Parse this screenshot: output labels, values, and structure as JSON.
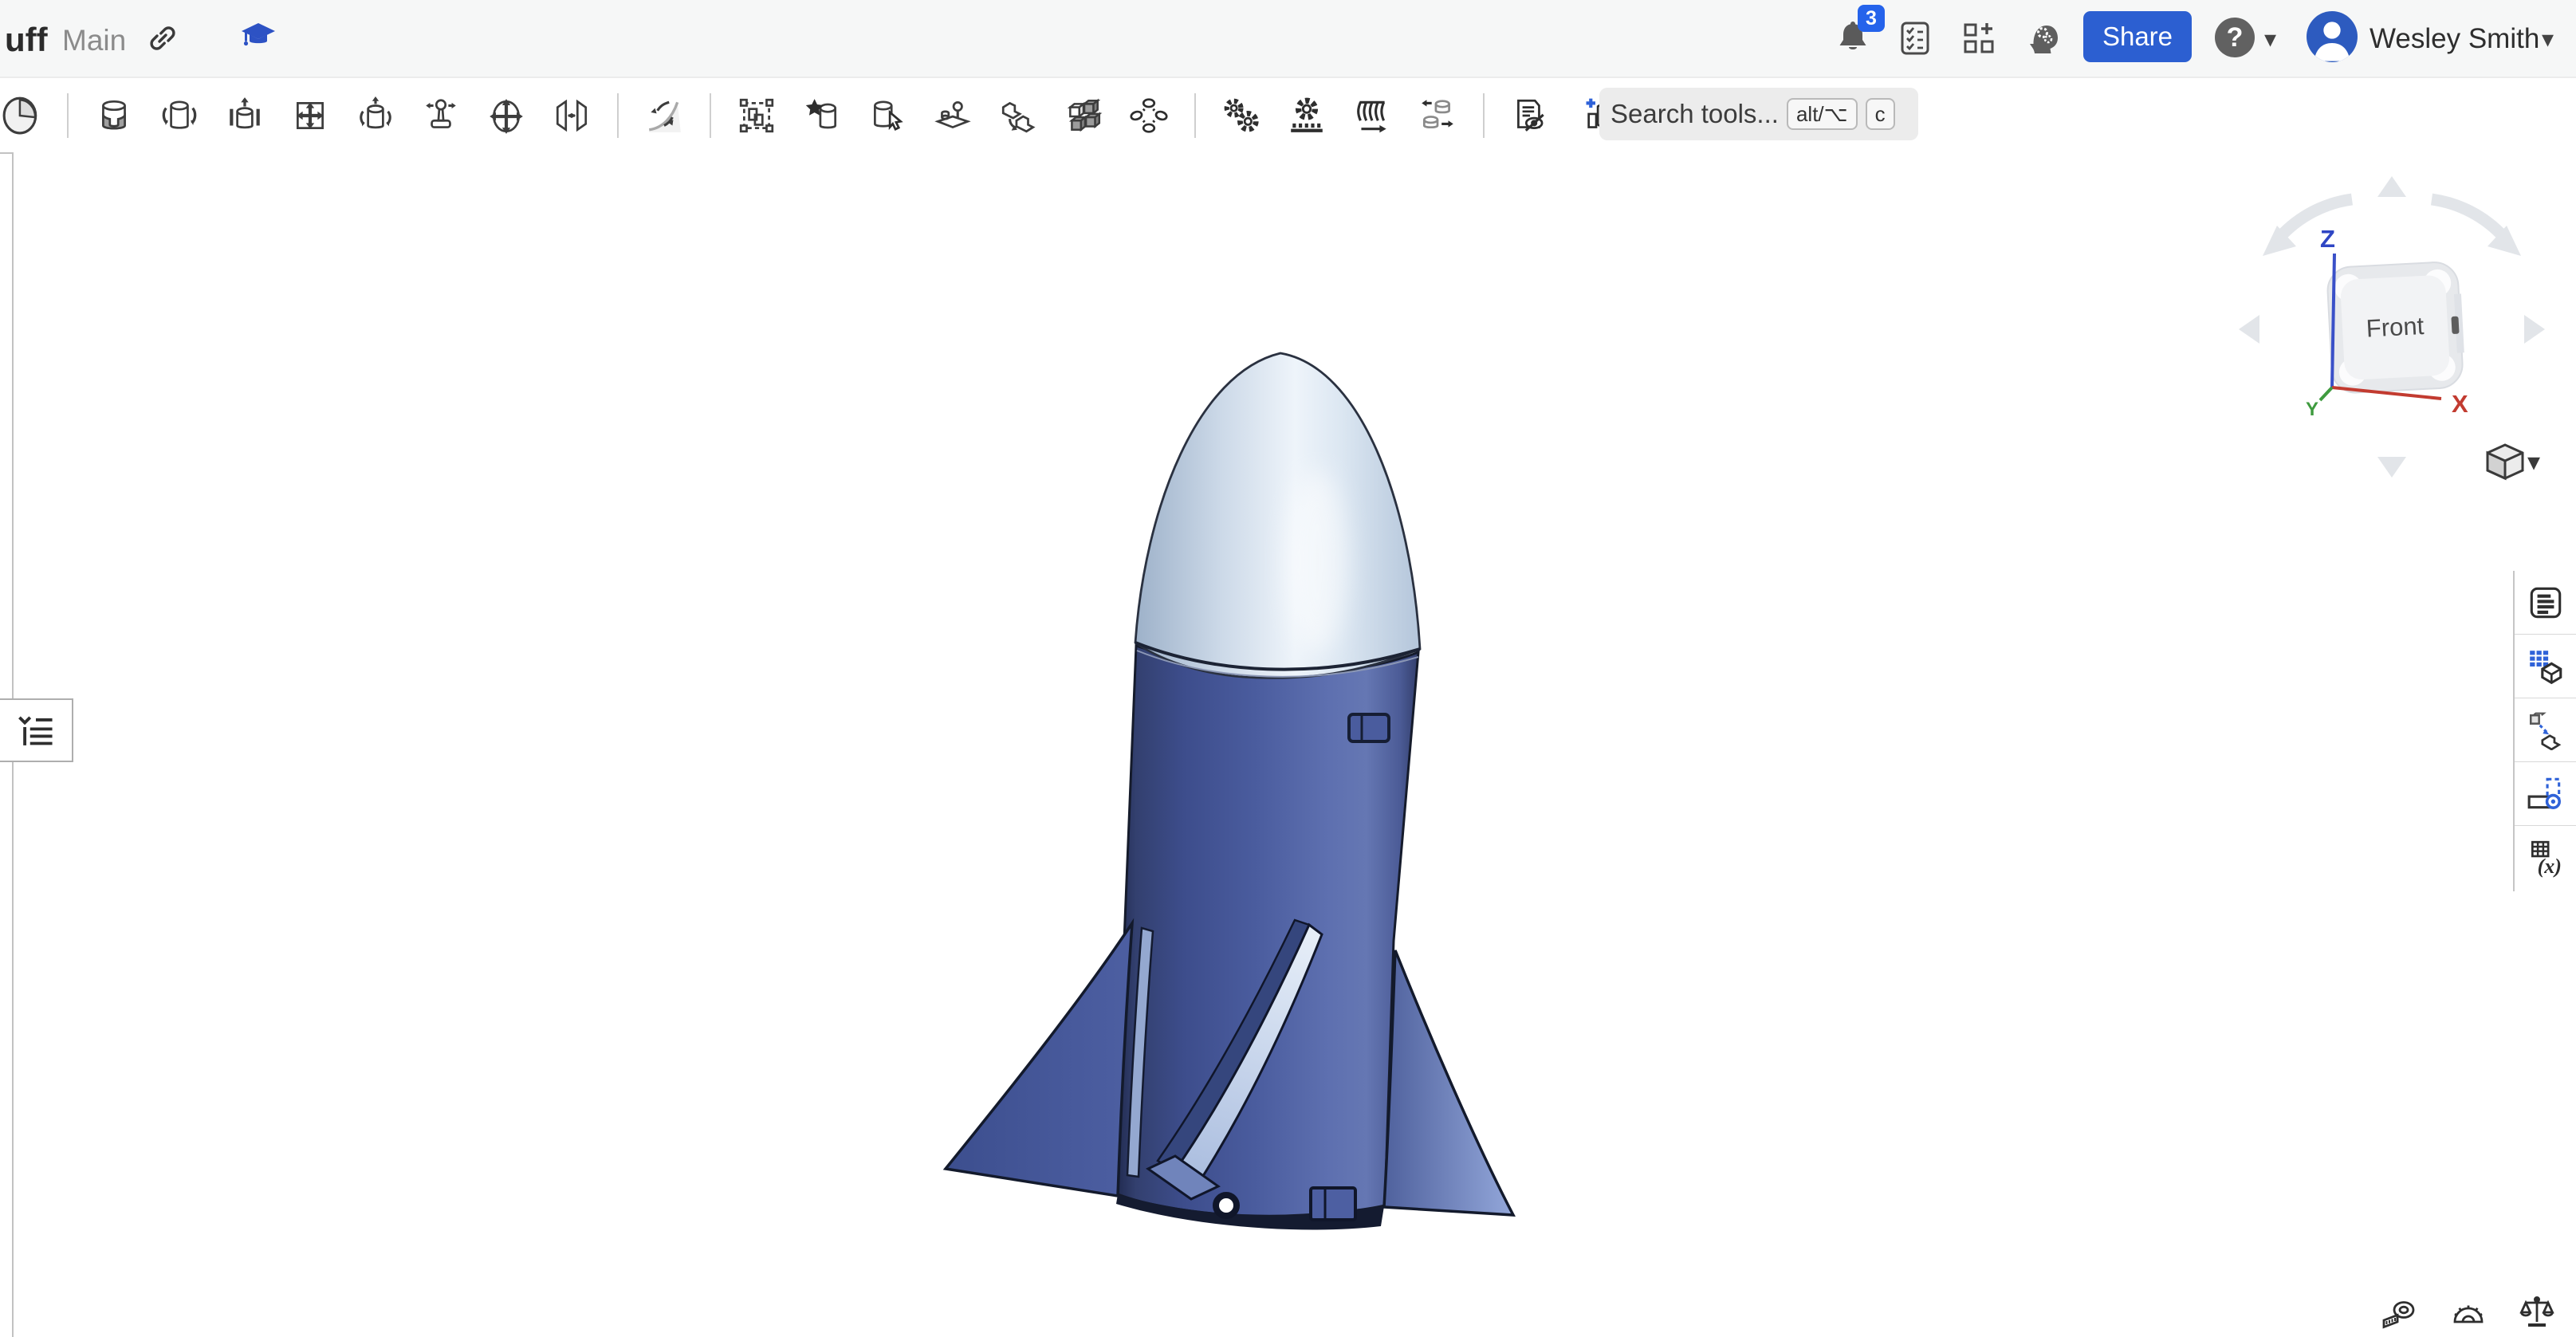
{
  "header": {
    "document_title_fragment": "uff",
    "workspace_label": "Main",
    "notification_badge": "3",
    "share_button": "Share",
    "user_name": "Wesley Smith",
    "icons": [
      "link-icon",
      "graduation-cap-icon",
      "notifications-bell-icon",
      "tasks-checklist-icon",
      "apps-grid-plus-icon",
      "ai-head-gears-icon",
      "help-icon",
      "caret-down-icon",
      "avatar-icon"
    ]
  },
  "toolbar": {
    "search": {
      "placeholder": "Search tools...",
      "keys": [
        "alt/⌥",
        "c"
      ]
    },
    "icons": [
      "sketch-pie-icon",
      "extrude-cylinder-icon",
      "revolve-icon",
      "sweep-icon",
      "loft-icon",
      "helix-icon",
      "rib-knob-icon",
      "move-face-icon",
      "mirror-icon",
      "fillet-icon",
      "transform-icon",
      "custom-star-part-icon",
      "select-part-icon",
      "assembly-block-icon",
      "derive-transfer-icon",
      "pattern-cubes-icon",
      "explode-parts-icon",
      "gears-pair-icon",
      "gear-rack-icon",
      "spring-icon",
      "cylinder-transfer-icon",
      "hide-features-doc-icon",
      "insert-column-plus-icon"
    ]
  },
  "view_cube": {
    "face_label": "Front",
    "axis_z": "Z",
    "axis_x": "X",
    "axis_y": "Y",
    "axis_colors": {
      "z": "#3a50c8",
      "x": "#c23b30",
      "y": "#3f9b3f"
    }
  },
  "right_panel": {
    "icons": [
      "feature-list-panel-icon",
      "configurations-panel-icon",
      "derived-parts-panel-icon",
      "sheet-metal-panel-icon",
      "variables-panel-icon"
    ],
    "variables_glyph": "(x)"
  },
  "bottom_tools": {
    "icons": [
      "tape-measure-icon",
      "protractor-icon",
      "mass-properties-scale-icon"
    ]
  },
  "canvas": {
    "model": "model rocket, front view",
    "part_colors": {
      "nose_cone": "#cfdce9",
      "body_tube": "#4a5c9e",
      "fins": "#4a5da3",
      "fin_edge_highlight": "#d5e3f4"
    }
  },
  "theme": {
    "accent_blue": "#2c5fd1",
    "badge_blue": "#2563eb",
    "header_bg": "#f6f7f7",
    "toolbar_bg": "#ffffff",
    "canvas_bg": "#ffffff"
  }
}
